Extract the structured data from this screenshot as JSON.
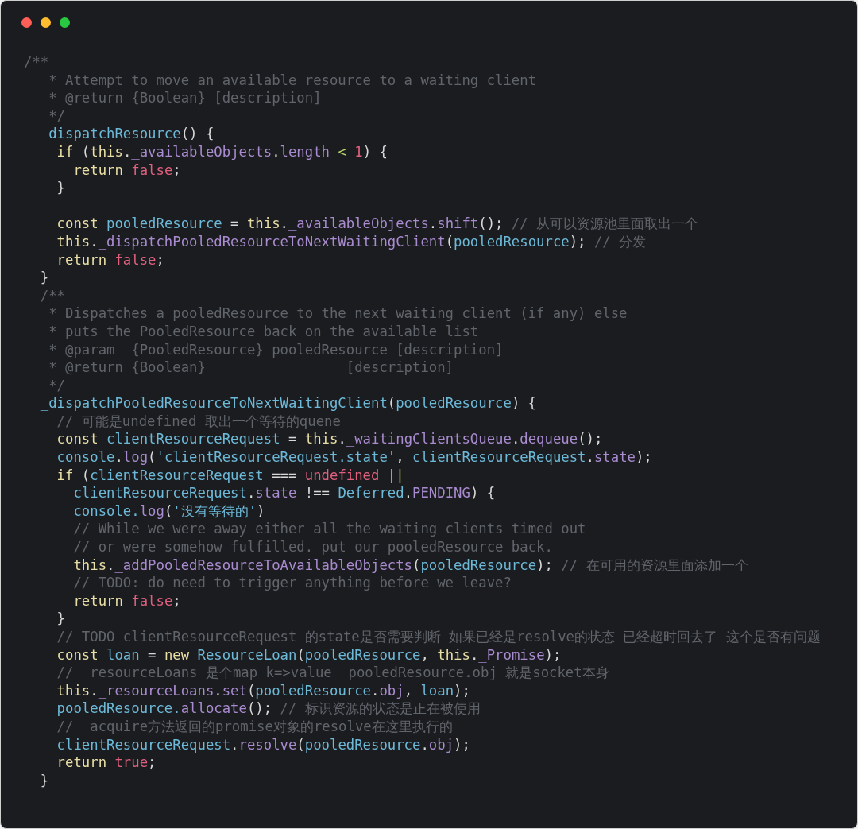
{
  "window": {
    "controls": [
      {
        "color": "#ff5f57"
      },
      {
        "color": "#febc2e"
      },
      {
        "color": "#28c840"
      }
    ]
  },
  "code": {
    "lines": [
      {
        "kind": "code",
        "tokens": [
          {
            "kind": "comment",
            "text": "/**"
          }
        ]
      },
      {
        "kind": "code",
        "tokens": [
          {
            "kind": "comment",
            "text": "   * Attempt to move an available resource to a waiting client"
          }
        ]
      },
      {
        "kind": "code",
        "tokens": [
          {
            "kind": "comment",
            "text": "   * @return {Boolean} [description]"
          }
        ]
      },
      {
        "kind": "code",
        "tokens": [
          {
            "kind": "comment",
            "text": "   */"
          }
        ]
      },
      {
        "kind": "code",
        "tokens": [
          {
            "kind": "fn",
            "text": "  _dispatchResource"
          },
          {
            "kind": "punct",
            "text": "() {"
          }
        ]
      },
      {
        "kind": "code",
        "tokens": [
          {
            "kind": "kw",
            "text": "    if"
          },
          {
            "kind": "punct",
            "text": " ("
          },
          {
            "kind": "kw",
            "text": "this"
          },
          {
            "kind": "punct",
            "text": "."
          },
          {
            "kind": "prop",
            "text": "_availableObjects"
          },
          {
            "kind": "punct",
            "text": "."
          },
          {
            "kind": "prop",
            "text": "length"
          },
          {
            "kind": "op",
            "text": " < "
          },
          {
            "kind": "lit",
            "text": "1"
          },
          {
            "kind": "punct",
            "text": ") {"
          }
        ]
      },
      {
        "kind": "code",
        "tokens": [
          {
            "kind": "kw",
            "text": "      return "
          },
          {
            "kind": "lit",
            "text": "false"
          },
          {
            "kind": "punct",
            "text": ";"
          }
        ]
      },
      {
        "kind": "code",
        "tokens": [
          {
            "kind": "punct",
            "text": "    }"
          }
        ]
      },
      {
        "kind": "blank"
      },
      {
        "kind": "code",
        "tokens": [
          {
            "kind": "kw",
            "text": "    const "
          },
          {
            "kind": "fn",
            "text": "pooledResource"
          },
          {
            "kind": "punct",
            "text": " = "
          },
          {
            "kind": "kw",
            "text": "this"
          },
          {
            "kind": "punct",
            "text": "."
          },
          {
            "kind": "prop",
            "text": "_availableObjects"
          },
          {
            "kind": "punct",
            "text": "."
          },
          {
            "kind": "prop",
            "text": "shift"
          },
          {
            "kind": "punct",
            "text": "(); "
          },
          {
            "kind": "comment",
            "text": "// 从可以资源池里面取出一个"
          }
        ]
      },
      {
        "kind": "code",
        "tokens": [
          {
            "kind": "kw",
            "text": "    this"
          },
          {
            "kind": "punct",
            "text": "."
          },
          {
            "kind": "prop",
            "text": "_dispatchPooledResourceToNextWaitingClient"
          },
          {
            "kind": "punct",
            "text": "("
          },
          {
            "kind": "fn",
            "text": "pooledResource"
          },
          {
            "kind": "punct",
            "text": "); "
          },
          {
            "kind": "comment",
            "text": "// 分发"
          }
        ]
      },
      {
        "kind": "code",
        "tokens": [
          {
            "kind": "kw",
            "text": "    return "
          },
          {
            "kind": "lit",
            "text": "false"
          },
          {
            "kind": "punct",
            "text": ";"
          }
        ]
      },
      {
        "kind": "code",
        "tokens": [
          {
            "kind": "punct",
            "text": "  }"
          }
        ]
      },
      {
        "kind": "code",
        "tokens": [
          {
            "kind": "comment",
            "text": "  /**"
          }
        ]
      },
      {
        "kind": "code",
        "tokens": [
          {
            "kind": "comment",
            "text": "   * Dispatches a pooledResource to the next waiting client (if any) else"
          }
        ]
      },
      {
        "kind": "code",
        "tokens": [
          {
            "kind": "comment",
            "text": "   * puts the PooledResource back on the available list"
          }
        ]
      },
      {
        "kind": "code",
        "tokens": [
          {
            "kind": "comment",
            "text": "   * @param  {PooledResource} pooledResource [description]"
          }
        ]
      },
      {
        "kind": "code",
        "tokens": [
          {
            "kind": "comment",
            "text": "   * @return {Boolean}                 [description]"
          }
        ]
      },
      {
        "kind": "code",
        "tokens": [
          {
            "kind": "comment",
            "text": "   */"
          }
        ]
      },
      {
        "kind": "code",
        "tokens": [
          {
            "kind": "fn",
            "text": "  _dispatchPooledResourceToNextWaitingClient"
          },
          {
            "kind": "punct",
            "text": "("
          },
          {
            "kind": "fn",
            "text": "pooledResource"
          },
          {
            "kind": "punct",
            "text": ") {"
          }
        ]
      },
      {
        "kind": "code",
        "tokens": [
          {
            "kind": "comment",
            "text": "    // 可能是undefined 取出一个等待的quene"
          }
        ]
      },
      {
        "kind": "code",
        "tokens": [
          {
            "kind": "kw",
            "text": "    const "
          },
          {
            "kind": "fn",
            "text": "clientResourceRequest"
          },
          {
            "kind": "punct",
            "text": " = "
          },
          {
            "kind": "kw",
            "text": "this"
          },
          {
            "kind": "punct",
            "text": "."
          },
          {
            "kind": "prop",
            "text": "_waitingClientsQueue"
          },
          {
            "kind": "punct",
            "text": "."
          },
          {
            "kind": "prop",
            "text": "dequeue"
          },
          {
            "kind": "punct",
            "text": "();"
          }
        ]
      },
      {
        "kind": "code",
        "tokens": [
          {
            "kind": "fn",
            "text": "    console"
          },
          {
            "kind": "punct",
            "text": "."
          },
          {
            "kind": "prop",
            "text": "log"
          },
          {
            "kind": "punct",
            "text": "("
          },
          {
            "kind": "str",
            "text": "'clientResourceRequest.state'"
          },
          {
            "kind": "punct",
            "text": ", "
          },
          {
            "kind": "fn",
            "text": "clientResourceRequest"
          },
          {
            "kind": "punct",
            "text": "."
          },
          {
            "kind": "prop",
            "text": "state"
          },
          {
            "kind": "punct",
            "text": ");"
          }
        ]
      },
      {
        "kind": "code",
        "tokens": [
          {
            "kind": "kw",
            "text": "    if"
          },
          {
            "kind": "punct",
            "text": " ("
          },
          {
            "kind": "fn",
            "text": "clientResourceRequest"
          },
          {
            "kind": "punct",
            "text": " === "
          },
          {
            "kind": "lit",
            "text": "undefined"
          },
          {
            "kind": "op",
            "text": " ||"
          }
        ]
      },
      {
        "kind": "code",
        "tokens": [
          {
            "kind": "fn",
            "text": "      clientResourceRequest"
          },
          {
            "kind": "punct",
            "text": "."
          },
          {
            "kind": "prop",
            "text": "state"
          },
          {
            "kind": "punct",
            "text": " !== "
          },
          {
            "kind": "fn",
            "text": "Deferred"
          },
          {
            "kind": "punct",
            "text": "."
          },
          {
            "kind": "prop",
            "text": "PENDING"
          },
          {
            "kind": "punct",
            "text": ") {"
          }
        ]
      },
      {
        "kind": "code",
        "tokens": [
          {
            "kind": "fn",
            "text": "      console."
          },
          {
            "kind": "prop",
            "text": "log"
          },
          {
            "kind": "punct",
            "text": "("
          },
          {
            "kind": "str",
            "text": "'没有等待的'"
          },
          {
            "kind": "punct",
            "text": ")"
          }
        ]
      },
      {
        "kind": "code",
        "tokens": [
          {
            "kind": "comment",
            "text": "      // While we were away either all the waiting clients timed out"
          }
        ]
      },
      {
        "kind": "code",
        "tokens": [
          {
            "kind": "comment",
            "text": "      // or were somehow fulfilled. put our pooledResource back."
          }
        ]
      },
      {
        "kind": "code",
        "tokens": [
          {
            "kind": "kw",
            "text": "      this"
          },
          {
            "kind": "punct",
            "text": "."
          },
          {
            "kind": "prop",
            "text": "_addPooledResourceToAvailableObjects"
          },
          {
            "kind": "punct",
            "text": "("
          },
          {
            "kind": "fn",
            "text": "pooledResource"
          },
          {
            "kind": "punct",
            "text": "); "
          },
          {
            "kind": "comment",
            "text": "// 在可用的资源里面添加一个"
          }
        ]
      },
      {
        "kind": "code",
        "tokens": [
          {
            "kind": "comment",
            "text": "      // TODO: do need to trigger anything before we leave?"
          }
        ]
      },
      {
        "kind": "code",
        "tokens": [
          {
            "kind": "kw",
            "text": "      return "
          },
          {
            "kind": "lit",
            "text": "false"
          },
          {
            "kind": "punct",
            "text": ";"
          }
        ]
      },
      {
        "kind": "code",
        "tokens": [
          {
            "kind": "punct",
            "text": "    }"
          }
        ]
      },
      {
        "kind": "code",
        "tokens": [
          {
            "kind": "comment",
            "text": "    // TODO clientResourceRequest 的state是否需要判断 如果已经是resolve的状态 已经超时回去了 这个是否有问题"
          }
        ]
      },
      {
        "kind": "code",
        "tokens": [
          {
            "kind": "kw",
            "text": "    const "
          },
          {
            "kind": "fn",
            "text": "loan"
          },
          {
            "kind": "punct",
            "text": " = "
          },
          {
            "kind": "kw",
            "text": "new "
          },
          {
            "kind": "fn",
            "text": "ResourceLoan"
          },
          {
            "kind": "punct",
            "text": "("
          },
          {
            "kind": "fn",
            "text": "pooledResource"
          },
          {
            "kind": "punct",
            "text": ", "
          },
          {
            "kind": "kw",
            "text": "this"
          },
          {
            "kind": "punct",
            "text": "."
          },
          {
            "kind": "prop",
            "text": "_Promise"
          },
          {
            "kind": "punct",
            "text": ");"
          }
        ]
      },
      {
        "kind": "code",
        "tokens": [
          {
            "kind": "comment",
            "text": "    // _resourceLoans 是个map k=>value  pooledResource.obj 就是socket本身"
          }
        ]
      },
      {
        "kind": "code",
        "tokens": [
          {
            "kind": "kw",
            "text": "    this"
          },
          {
            "kind": "punct",
            "text": "."
          },
          {
            "kind": "prop",
            "text": "_resourceLoans"
          },
          {
            "kind": "punct",
            "text": "."
          },
          {
            "kind": "prop",
            "text": "set"
          },
          {
            "kind": "punct",
            "text": "("
          },
          {
            "kind": "fn",
            "text": "pooledResource"
          },
          {
            "kind": "punct",
            "text": "."
          },
          {
            "kind": "prop",
            "text": "obj"
          },
          {
            "kind": "punct",
            "text": ", "
          },
          {
            "kind": "fn",
            "text": "loan"
          },
          {
            "kind": "punct",
            "text": ");"
          }
        ]
      },
      {
        "kind": "code",
        "tokens": [
          {
            "kind": "fn",
            "text": "    pooledResource."
          },
          {
            "kind": "prop",
            "text": "allocate"
          },
          {
            "kind": "punct",
            "text": "(); "
          },
          {
            "kind": "comment",
            "text": "// 标识资源的状态是正在被使用"
          }
        ]
      },
      {
        "kind": "code",
        "tokens": [
          {
            "kind": "comment",
            "text": "    //  acquire方法返回的promise对象的resolve在这里执行的"
          }
        ]
      },
      {
        "kind": "code",
        "tokens": [
          {
            "kind": "fn",
            "text": "    clientResourceRequest"
          },
          {
            "kind": "punct",
            "text": "."
          },
          {
            "kind": "prop",
            "text": "resolve"
          },
          {
            "kind": "punct",
            "text": "("
          },
          {
            "kind": "fn",
            "text": "pooledResource"
          },
          {
            "kind": "punct",
            "text": "."
          },
          {
            "kind": "prop",
            "text": "obj"
          },
          {
            "kind": "punct",
            "text": ");"
          }
        ]
      },
      {
        "kind": "code",
        "tokens": [
          {
            "kind": "kw",
            "text": "    return "
          },
          {
            "kind": "lit",
            "text": "true"
          },
          {
            "kind": "punct",
            "text": ";"
          }
        ]
      },
      {
        "kind": "code",
        "tokens": [
          {
            "kind": "punct",
            "text": "  }"
          }
        ]
      }
    ]
  }
}
